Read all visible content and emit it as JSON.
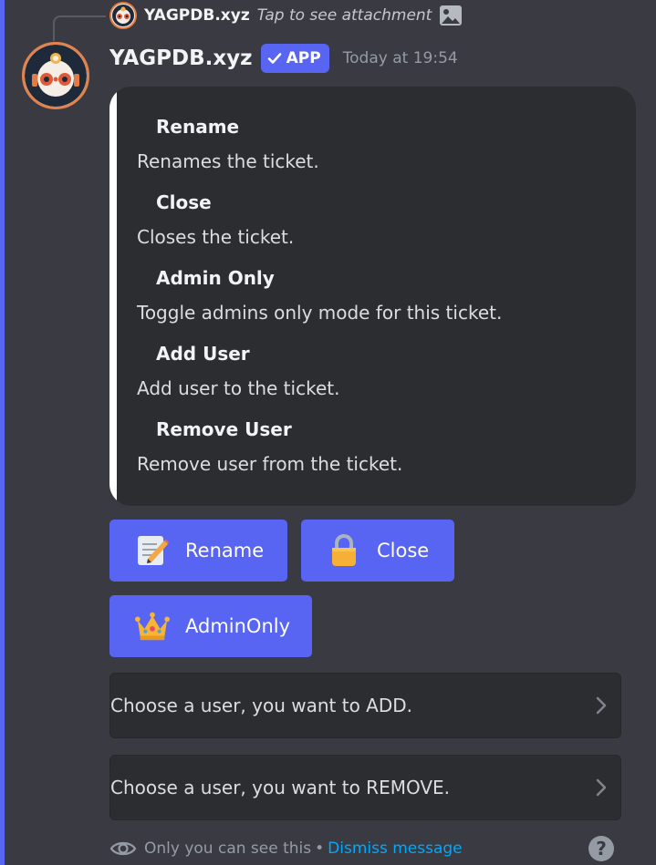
{
  "reply": {
    "author": "YAGPDB.xyz",
    "text": "Tap to see attachment",
    "icon": "image-icon"
  },
  "message": {
    "author": "YAGPDB.xyz",
    "badge": "APP",
    "timestamp": "Today at 19:54"
  },
  "embed": {
    "accent_color": "#ffffff",
    "fields": [
      {
        "name": "Rename",
        "value": "Renames the ticket."
      },
      {
        "name": "Close",
        "value": "Closes the ticket."
      },
      {
        "name": "Admin Only",
        "value": "Toggle admins only mode for this ticket."
      },
      {
        "name": "Add User",
        "value": "Add user to the ticket."
      },
      {
        "name": "Remove User",
        "value": "Remove user from the ticket."
      }
    ]
  },
  "buttons": [
    {
      "label": "Rename",
      "icon": "memo-icon"
    },
    {
      "label": "Close",
      "icon": "lock-icon"
    },
    {
      "label": "AdminOnly",
      "icon": "crown-icon"
    }
  ],
  "selects": [
    {
      "placeholder": "Choose a user, you want to ADD."
    },
    {
      "placeholder": "Choose a user, you want to REMOVE."
    }
  ],
  "footer": {
    "notice": "Only you can see this",
    "separator": "•",
    "dismiss": "Dismiss message",
    "help": "?"
  },
  "colors": {
    "blurple": "#5865f2",
    "link": "#00a8fc",
    "background": "#3a3b42",
    "embed_bg": "#2b2d31"
  }
}
